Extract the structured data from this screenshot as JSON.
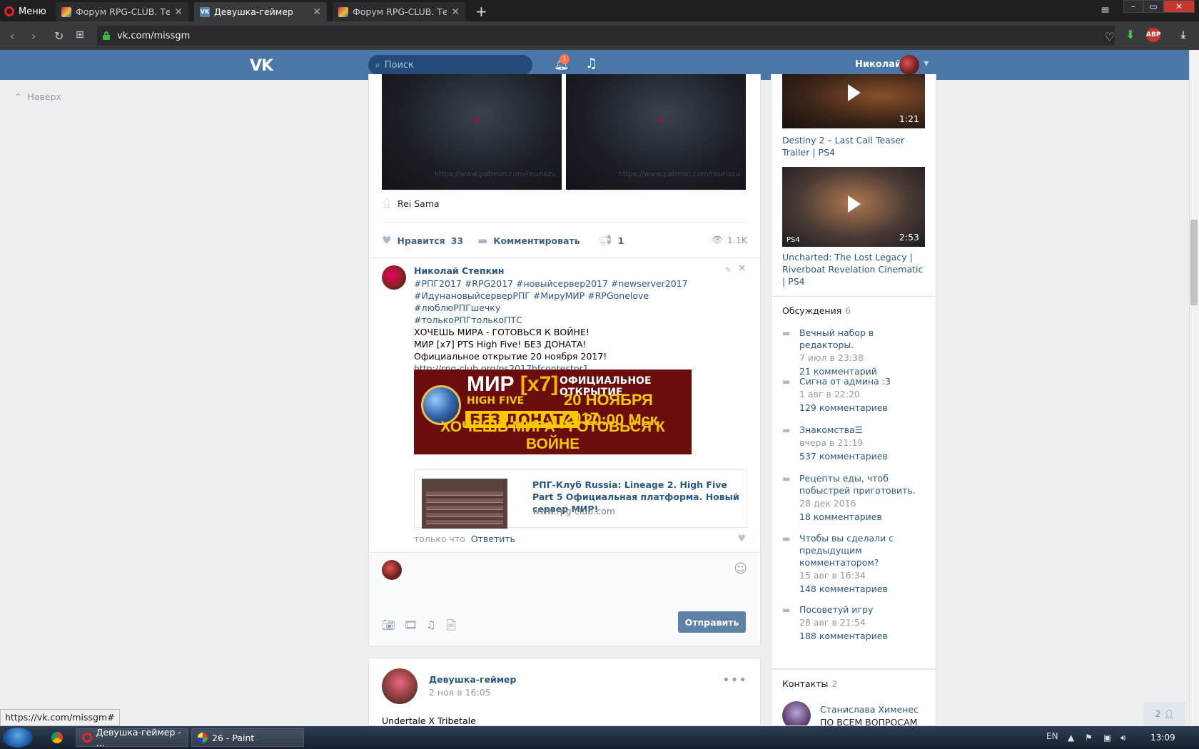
{
  "browser": {
    "menu_label": "Меню",
    "tabs": [
      {
        "title": "Форум RPG-CLUB. Тема: I"
      },
      {
        "title": "Девушка-геймер"
      },
      {
        "title": "Форум RPG-CLUB. Тема: I"
      }
    ],
    "url": "vk.com/missgm",
    "ext_abp": "ABP"
  },
  "header": {
    "logo": "VK",
    "search_placeholder": "Поиск",
    "notif_count": "1",
    "user_name": "Николай"
  },
  "sidebar_left": {
    "up_label": "Наверх"
  },
  "post1": {
    "watermark": "https://www.patreon.com/rouriazu",
    "author": "Rei Sama",
    "like_label": "Нравится",
    "like_count": "33",
    "comment_label": "Комментировать",
    "share_count": "1",
    "views": "1.1K"
  },
  "comment": {
    "author": "Николай Степкин",
    "hashtags_1": "#РПГ2017 #RPG2017 #новыйсервер2017 #newserver2017",
    "hashtags_2": "#ИдунановыйсерверРПГ #МируМИР #RPGonelove #люблюРПГшечку",
    "hashtags_3": "#толькоРПГтолькоПТС",
    "line_1": "ХОЧЕШЬ МИРА - ГОТОВЬСЯ К ВОЙНЕ!",
    "line_2": "МИР [x7] PTS High Five! БЕЗ ДОНАТА!",
    "line_3": "Официальное открытие 20 ноября 2017!",
    "link": "http://rpg-club.org/ns2017hfcontestpr1",
    "banner": {
      "mir": "МИР",
      "x7": "[x7]",
      "high_five": "HIGH FIVE",
      "bez_donata": "БЕЗ ДОНАТА",
      "official": "ОФИЦИАЛЬНОЕ ОТКРЫТИЕ",
      "date": "20 НОЯБРЯ 2017",
      "time": "20:00 Мск",
      "slogan": "ХОЧЕШЬ МИРА - ГОТОВЬСЯ К ВОЙНЕ"
    },
    "link_card": {
      "title": "РПГ-Клуб Russia: Lineage 2. High Five Part 5 Официальная платформа. Новый сервер МИР!",
      "domain": "www.rpg-club.com"
    },
    "time": "только что",
    "reply_label": "Ответить",
    "send_label": "Отправить"
  },
  "post3": {
    "author": "Девушка-геймер",
    "date": "2 ноя в 16:05",
    "text": "Undertale X Tribetale"
  },
  "right_videos": [
    {
      "duration": "1:21",
      "title": "Destiny 2 – Last Call Teaser Trailer | PS4"
    },
    {
      "duration": "2:53",
      "badge": "PS4",
      "title": "Uncharted: The Lost Legacy | Riverboat Revelation Cinematic | PS4"
    }
  ],
  "discussions": {
    "title": "Обсуждения",
    "count": "6",
    "items": [
      {
        "title": "Вечный набор в редакторы.",
        "date": "7 июл в 23:38",
        "comments": "21 комментарий"
      },
      {
        "title": "Сигна от админа :3",
        "date": "1 авг в 22:20",
        "comments": "129 комментариев"
      },
      {
        "title": "Знакомства☰",
        "date": "вчера в 21:19",
        "comments": "537 комментариев"
      },
      {
        "title": "Рецепты еды, чтоб побыстрей приготовить.",
        "date": "28 дек 2016",
        "comments": "18 комментариев"
      },
      {
        "title": "Чтобы вы сделали с предыдущим комментатором?",
        "date": "15 авг в 16:34",
        "comments": "148 комментариев"
      },
      {
        "title": "Посоветуй игру",
        "date": "28 авг в 21:54",
        "comments": "188 комментариев"
      }
    ]
  },
  "contacts": {
    "title": "Контакты",
    "count": "2",
    "name": "Станислава Хименес",
    "desc": "ПО ВСЕМ ВОПРОСАМ"
  },
  "friends_online": "2",
  "status_link": "https://vk.com/missgm#",
  "taskbar": {
    "task1": "Девушка-геймер - ...",
    "task2": "26 - Paint",
    "lang": "EN",
    "clock": "13:09"
  }
}
